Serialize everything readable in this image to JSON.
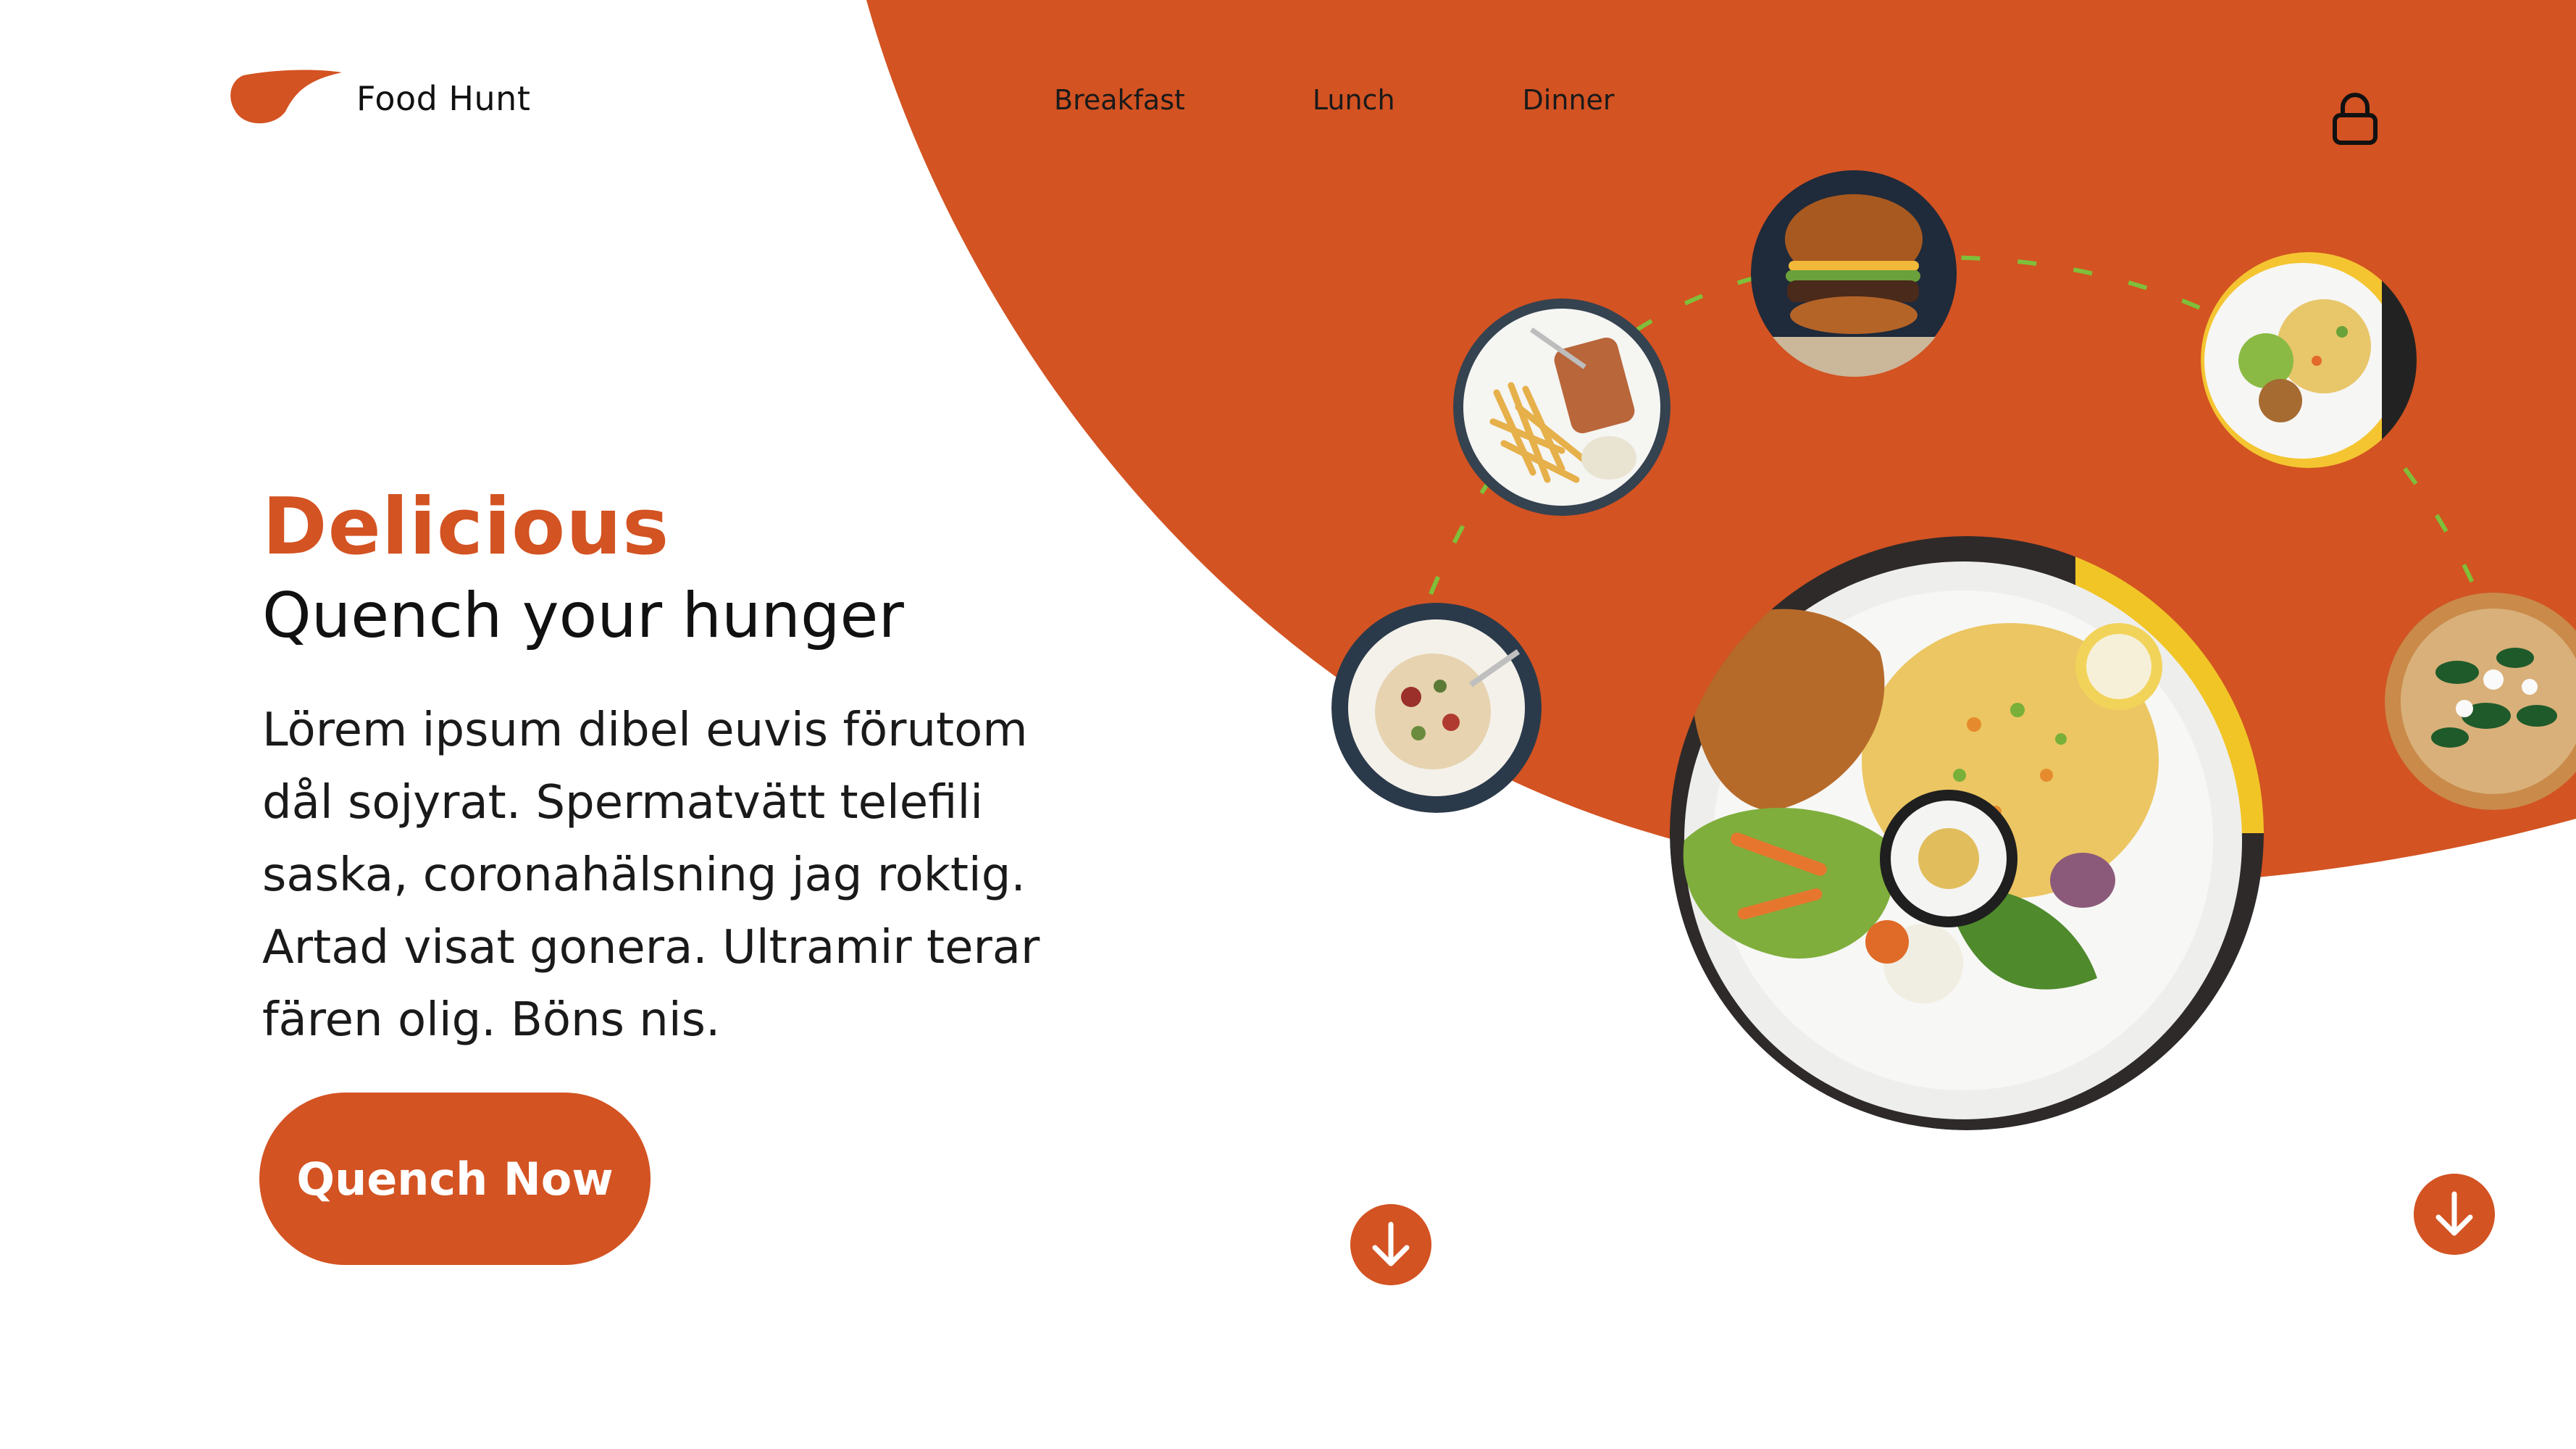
{
  "brand": {
    "name": "Food Hunt",
    "accent_color": "#d35322"
  },
  "nav": {
    "items": [
      "Breakfast",
      "Lunch",
      "Dinner"
    ],
    "cart_icon": "lock-icon"
  },
  "hero": {
    "title": "Delicious",
    "subtitle": "Quench your hunger",
    "body": "Lörem ipsum dibel euvis förutom dål sojyrat. Spermatvätt telefili saska, coronahälsning jag roktig. Artad visat gonera. Ultramir terar fären olig. Böns nis.",
    "cta_label": "Quench Now"
  },
  "dishes": {
    "featured": "rice-plate-image",
    "carousel": [
      "pasta-plate-image",
      "fish-and-chips-image",
      "burger-image",
      "rice-bowl-image",
      "pizza-image"
    ]
  },
  "controls": {
    "scroll_down_icon": "arrow-down-icon"
  }
}
